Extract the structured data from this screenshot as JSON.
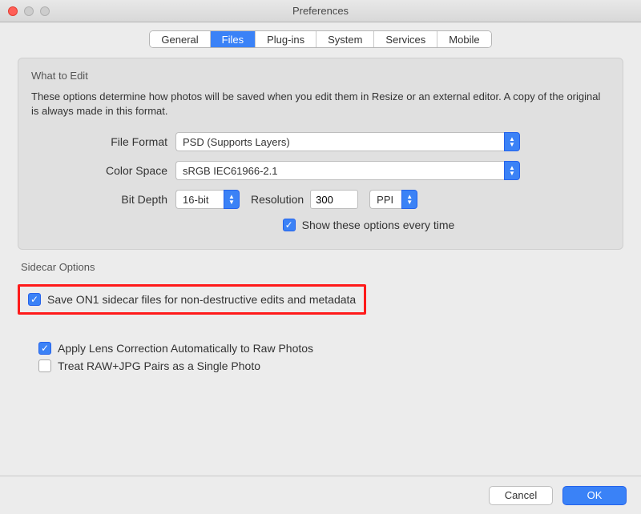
{
  "window": {
    "title": "Preferences"
  },
  "tabs": {
    "general": "General",
    "files": "Files",
    "plugins": "Plug-ins",
    "system": "System",
    "services": "Services",
    "mobile": "Mobile"
  },
  "what_to_edit": {
    "title": "What to Edit",
    "desc": "These options determine how photos will be saved when you edit them in Resize or an external editor.  A copy of the original is always made in this format.",
    "file_format_label": "File Format",
    "file_format_value": "PSD (Supports Layers)",
    "color_space_label": "Color Space",
    "color_space_value": "sRGB IEC61966-2.1",
    "bit_depth_label": "Bit Depth",
    "bit_depth_value": "16-bit",
    "resolution_label": "Resolution",
    "resolution_value": "300",
    "resolution_unit": "PPI",
    "show_options_label": "Show these options every time"
  },
  "sidecar": {
    "title": "Sidecar Options",
    "save_sidecar_label": "Save ON1 sidecar files for non-destructive edits and metadata",
    "lens_correction_label": "Apply Lens Correction Automatically to Raw Photos",
    "treat_raw_jpg_label": "Treat RAW+JPG Pairs as a Single Photo"
  },
  "footer": {
    "cancel": "Cancel",
    "ok": "OK"
  }
}
